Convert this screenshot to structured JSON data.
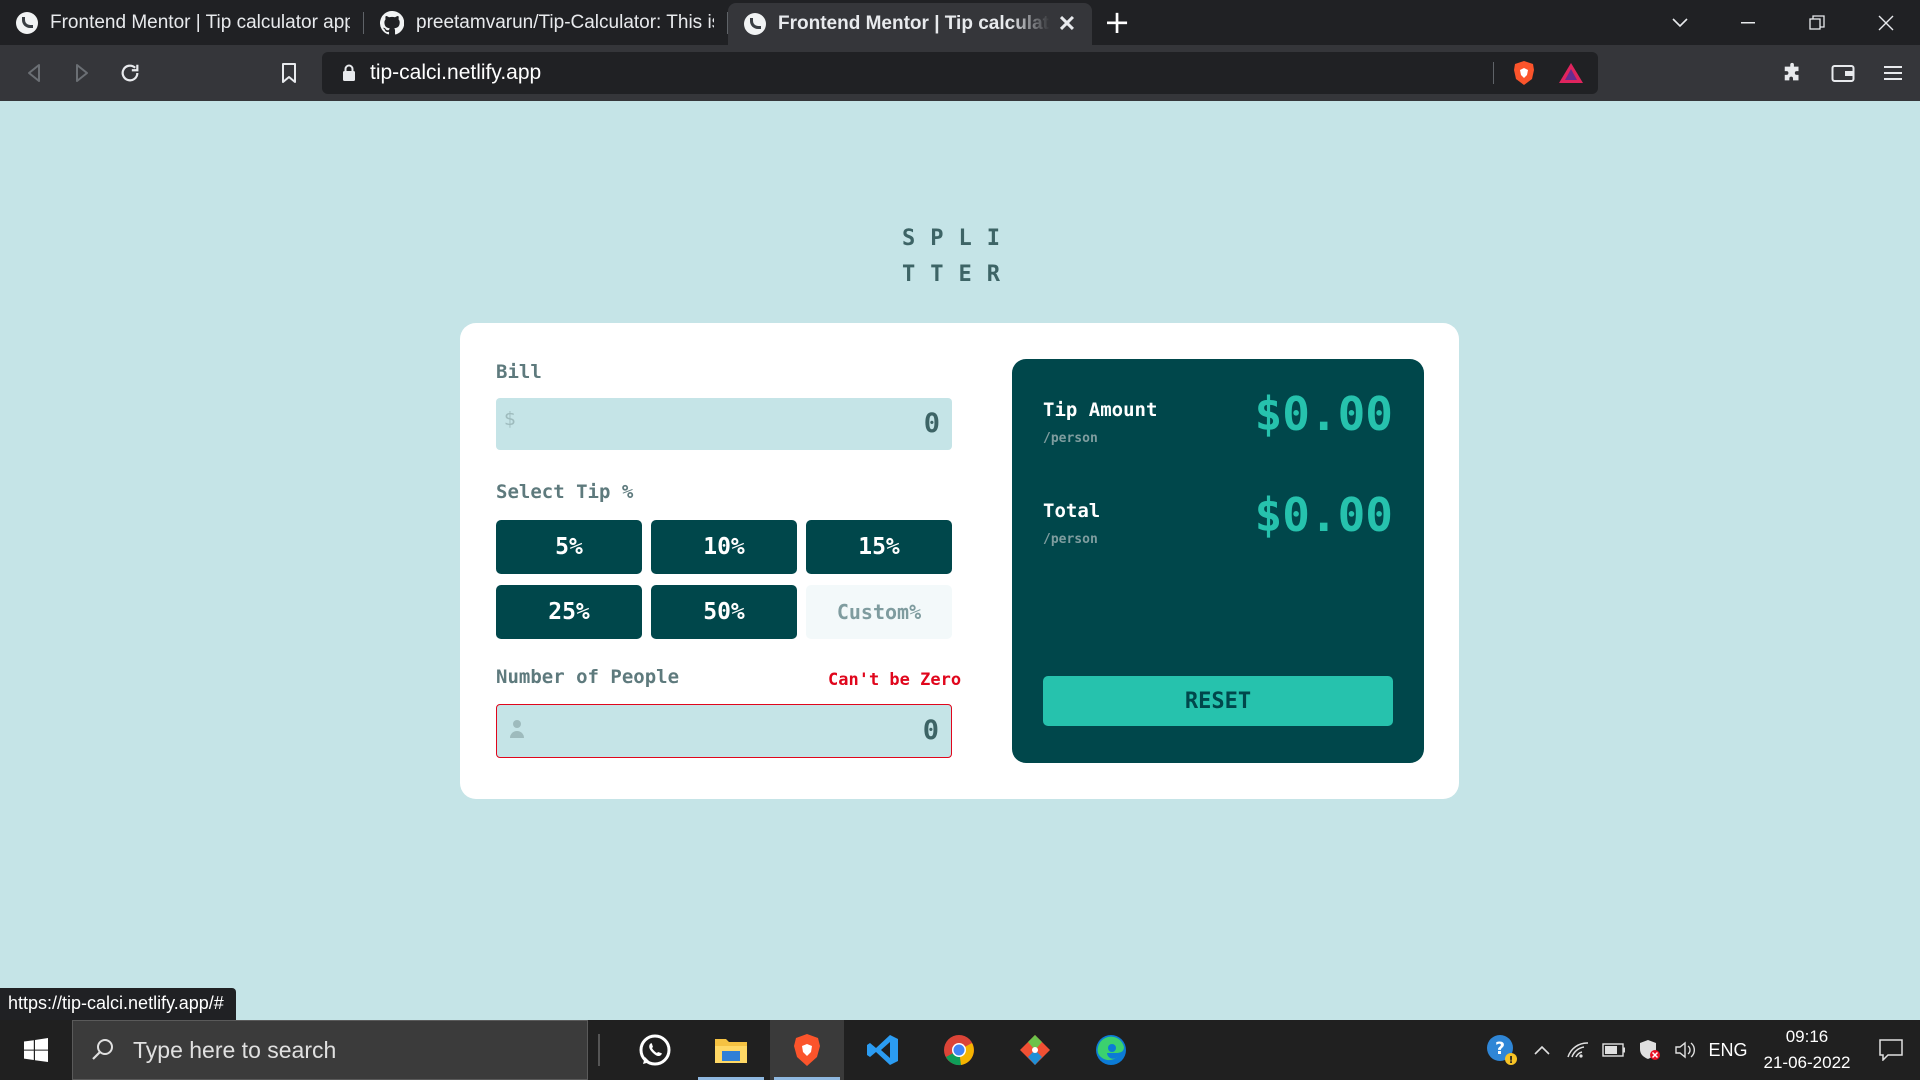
{
  "browser": {
    "tabs": [
      {
        "label": "Frontend Mentor | Tip calculator app",
        "active": false,
        "favicon": "frontend-mentor-icon"
      },
      {
        "label": "preetamvarun/Tip-Calculator: This is a",
        "active": false,
        "favicon": "github-icon"
      },
      {
        "label": "Frontend Mentor | Tip calculator app",
        "active": true,
        "favicon": "frontend-mentor-icon"
      }
    ],
    "url": "tip-calci.netlify.app",
    "status_url": "https://tip-calci.netlify.app/#"
  },
  "app": {
    "logo_line1": "SPLI",
    "logo_line2": "TTER",
    "bill": {
      "label": "Bill",
      "value": "0",
      "currency_symbol": "$"
    },
    "tip": {
      "label": "Select Tip %",
      "options": [
        "5%",
        "10%",
        "15%",
        "25%",
        "50%"
      ],
      "custom_placeholder": "Custom%"
    },
    "people": {
      "label": "Number of People",
      "value": "0",
      "error": "Can't be Zero"
    },
    "result": {
      "tip_label": "Tip Amount",
      "tip_sub": "/person",
      "tip_value": "$0.00",
      "total_label": "Total",
      "total_sub": "/person",
      "total_value": "$0.00",
      "reset_label": "RESET"
    },
    "colors": {
      "dark_cyan": "#00474b",
      "strong_cyan": "#26c2ad",
      "light_cyan": "#c5e4e7",
      "error": "#e0061c"
    }
  },
  "taskbar": {
    "search_placeholder": "Type here to search",
    "apps": [
      "whatsapp-icon",
      "file-explorer-icon",
      "brave-browser-icon",
      "vscode-icon",
      "chrome-icon",
      "git-icon",
      "edge-icon"
    ],
    "language": "ENG",
    "time": "09:16",
    "date": "21-06-2022"
  }
}
